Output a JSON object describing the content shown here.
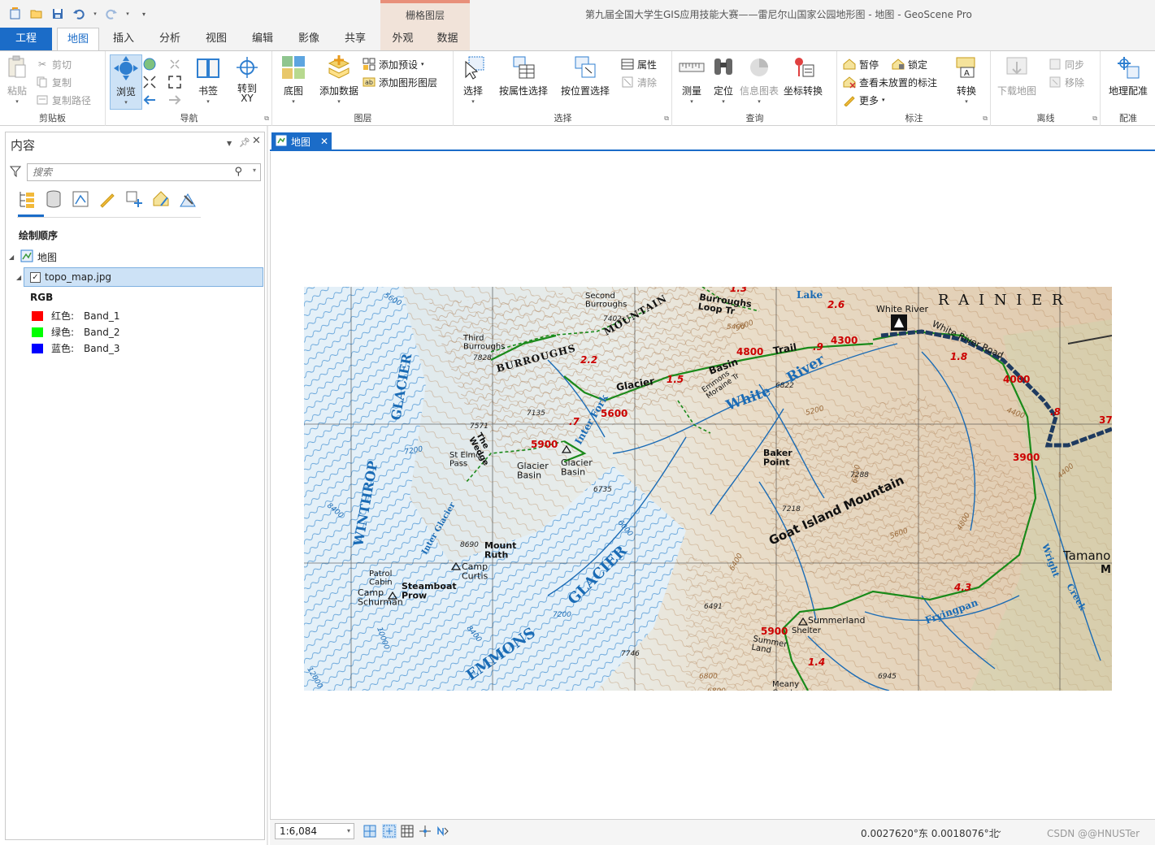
{
  "titlebar": {
    "context_tab_header": "栅格图层",
    "window_title": "第九届全国大学生GIS应用技能大赛——雷尼尔山国家公园地形图 - 地图 - GeoScene Pro"
  },
  "ribbon_tabs": {
    "project": "工程",
    "map": "地图",
    "insert": "插入",
    "analysis": "分析",
    "view": "视图",
    "edit": "编辑",
    "imagery": "影像",
    "share": "共享",
    "appearance": "外观",
    "data": "数据"
  },
  "ribbon": {
    "clipboard": {
      "label": "剪贴板",
      "paste": "粘贴",
      "cut": "剪切",
      "copy": "复制",
      "copy_path": "复制路径"
    },
    "navigate": {
      "label": "导航",
      "explore": "浏览",
      "bookmarks": "书签",
      "goto_xy": "转到\nXY"
    },
    "layer": {
      "label": "图层",
      "basemap": "底图",
      "add_data": "添加数据",
      "add_preset": "添加预设",
      "add_graphics_layer": "添加图形图层"
    },
    "selection": {
      "label": "选择",
      "select": "选择",
      "select_by_attributes": "按属性选择",
      "select_by_location": "按位置选择",
      "attributes": "属性",
      "clear": "清除"
    },
    "inquiry": {
      "label": "查询",
      "measure": "测量",
      "locate": "定位",
      "infographics": "信息图表",
      "convert_coordinates": "坐标转换"
    },
    "labeling": {
      "label": "标注",
      "pause": "暂停",
      "lock": "锁定",
      "view_unplaced": "查看未放置的标注",
      "more": "更多",
      "convert": "转换"
    },
    "offline": {
      "label": "离线",
      "download_map": "下载地图",
      "sync": "同步",
      "remove": "移除"
    },
    "georeference": {
      "label": "配准",
      "georeference_btn": "地理配准"
    }
  },
  "contents": {
    "title": "内容",
    "search_placeholder": "搜索",
    "drawing_order": "绘制顺序",
    "map_node": "地图",
    "layer_name": "topo_map.jpg",
    "rgb_label": "RGB",
    "bands": [
      {
        "channel": "红色:",
        "band": "Band_1",
        "color": "#ff0000"
      },
      {
        "channel": "绿色:",
        "band": "Band_2",
        "color": "#00ff00"
      },
      {
        "channel": "蓝色:",
        "band": "Band_3",
        "color": "#0000ff"
      }
    ]
  },
  "map_view": {
    "tab_label": "地图",
    "labels": {
      "rainier": "R A I N I E R",
      "white_river": "White River",
      "white_river_road": "White River Road",
      "burroughs_mountain": "BURROUGHS",
      "mountain": "MOUNTAIN",
      "glacier_basin_trail": "Glacier",
      "basin": "Basin",
      "trail": "Trail",
      "winthrop_glacier": "WINTHROP",
      "glacier_vertical": "GLACIER",
      "emmons": "EMMONS",
      "emmons_glacier": "GLACIER",
      "goat_island_mountain": "Goat   Island   Mountain",
      "white": "White",
      "river": "River",
      "inter_fork": "Inter  Fork",
      "baker_point": "Baker\nPoint",
      "glacier_basin": "Glacier\nBasin",
      "glacier_basin2": "Glacier\nBasin",
      "st_elmo_pass": "St Elmo\nPass",
      "mount_ruth": "Mount\nRuth",
      "camp_curtis": "Camp\nCurtis",
      "steamboat_prow": "Steamboat\nProw",
      "camp_schurman": "Camp\nSchurman",
      "patrol_cabin": "Patrol\nCabin",
      "summerland": "Summerland",
      "shelter": "Shelter",
      "fryingpan": "Fryingpan",
      "wright_creek": "Wright",
      "creek": "Creek",
      "tamanos": "Tamano",
      "third_burroughs": "Third\nBurroughs",
      "second_burroughs": "Second\nBurroughs",
      "the_wedge": "The\nWedge",
      "inter_glacier": "Inter Glacier",
      "burroughs_loop": "Burroughs\nLoop Tr",
      "lake": "Lake",
      "emmons_moraine": "Emmons\nMoraine Tr",
      "elev_4800": "4800",
      "elev_4300": "4300",
      "elev_4000": "4000",
      "elev_3900": "3900",
      "elev_5600": "5600",
      "elev_5900": "5900",
      "elev_5900b": "5900",
      "dist_22": "2.2",
      "dist_15": "1.5",
      "dist_18": "1.8",
      "dist_26": "2.6",
      "dist_43": "4.3",
      "dist_14": "1.4",
      "dist_9": ".9",
      "dist_8": ".8",
      "dist_7": ".7",
      "dist_13": "1.3",
      "spot_7402": "7402",
      "spot_7828": "7828",
      "spot_7135": "7135",
      "spot_7571": "7571",
      "spot_6735": "6735",
      "spot_6822": "6822",
      "spot_7288": "7288",
      "spot_7218": "7218",
      "spot_6491": "6491",
      "spot_6945": "6945",
      "spot_7746": "7746",
      "spot_8690": "8690",
      "c_5600": "5600",
      "c_7200": "7200",
      "c_8400": "8400",
      "c_6000": "6000",
      "c_5200": "5200",
      "c_6800": "6800",
      "c_7200b": "7200",
      "c_10000": "10000",
      "c_12000": "12000",
      "c_8400b": "8400",
      "c_5600b": "5600",
      "c_4800": "4800",
      "c_4400": "4400",
      "c_6400": "6400",
      "c_5600c": "5600",
      "c_6800b": "6800",
      "c_4400b": "4400",
      "c_6800c": "6800",
      "c_5400": "5400",
      "c_37": "37",
      "meany_crest": "Meany\nCrest",
      "summer_land": "Summer\nLand",
      "m_label": "M"
    }
  },
  "status": {
    "scale": "1:6,084",
    "coordinates": "0.0027620°东  0.0018076°北",
    "watermark": "CSDN @@HNUSTer"
  },
  "colors": {
    "accent": "#1b6cc8",
    "context_tab": "#f1e3d9",
    "context_tab_top": "#e8907a",
    "trail_green": "#1a8a1a",
    "road_navy": "#1e3a5f",
    "elevation_red": "#cc0000",
    "water_blue": "#1a6bb5",
    "glacier_blue": "#2a8ad0"
  }
}
